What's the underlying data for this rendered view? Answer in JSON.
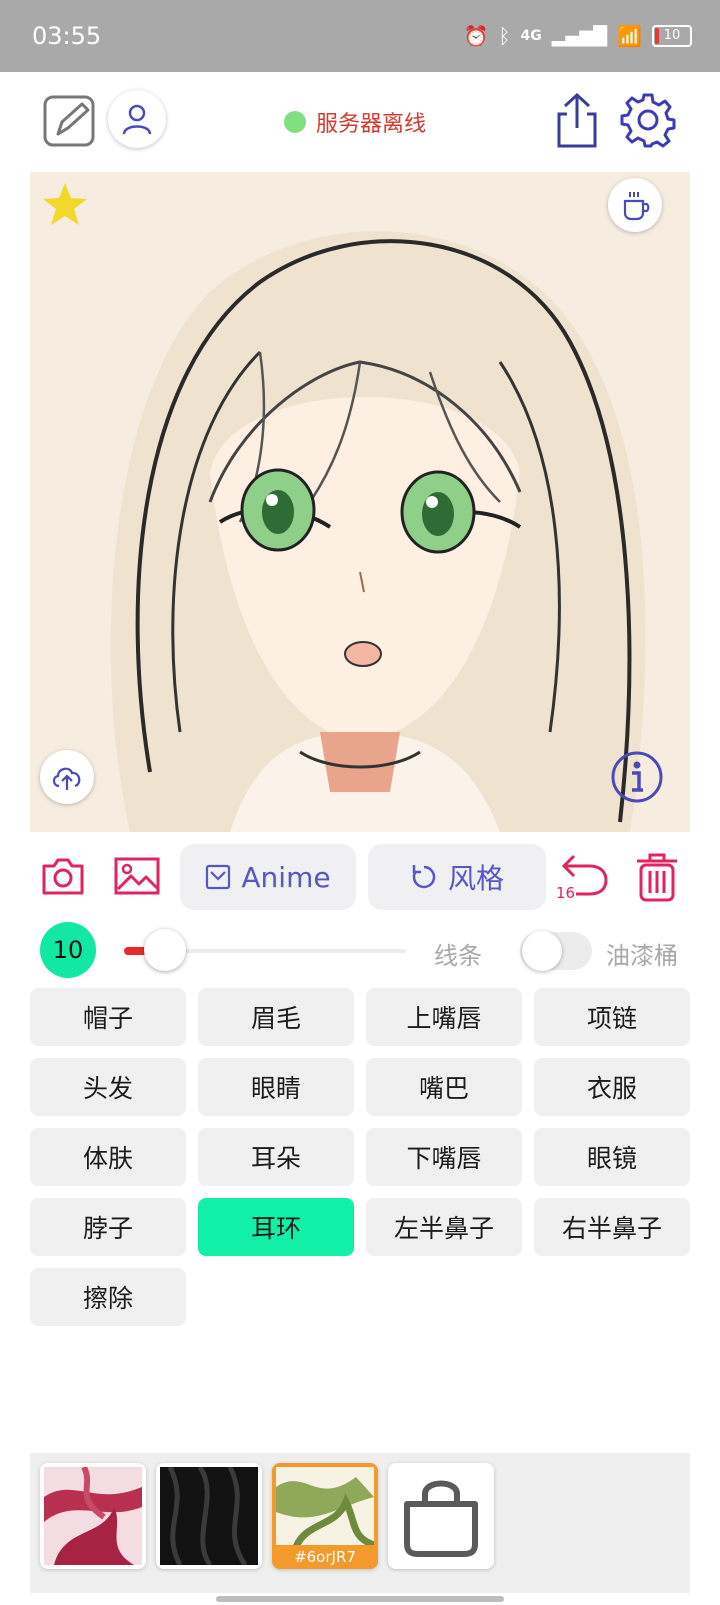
{
  "status_bar": {
    "time": "03:55",
    "network": "4G",
    "battery": "10"
  },
  "toolbar": {
    "server_status": "服务器离线"
  },
  "tools": {
    "mode_label": "Anime",
    "style_label": "风格",
    "undo_count": "16"
  },
  "brush": {
    "size": "10",
    "line_label": "线条",
    "bucket_label": "油漆桶",
    "slider_level": 0.1
  },
  "parts": [
    {
      "label": "帽子"
    },
    {
      "label": "眉毛"
    },
    {
      "label": "上嘴唇"
    },
    {
      "label": "项链"
    },
    {
      "label": "头发"
    },
    {
      "label": "眼睛"
    },
    {
      "label": "嘴巴"
    },
    {
      "label": "衣服"
    },
    {
      "label": "体肤"
    },
    {
      "label": "耳朵"
    },
    {
      "label": "下嘴唇"
    },
    {
      "label": "眼镜"
    },
    {
      "label": "脖子"
    },
    {
      "label": "耳环",
      "active": true
    },
    {
      "label": "左半鼻子"
    },
    {
      "label": "右半鼻子"
    },
    {
      "label": "擦除"
    }
  ],
  "palette": {
    "selected_tag": "#6orJR7"
  },
  "colors": {
    "accent": "#5656c6",
    "active_part": "#12f0a8",
    "size_badge": "#12e8a2",
    "danger": "#e0245e",
    "server_dot": "#7ee07e",
    "server_text": "#d33a2f"
  }
}
